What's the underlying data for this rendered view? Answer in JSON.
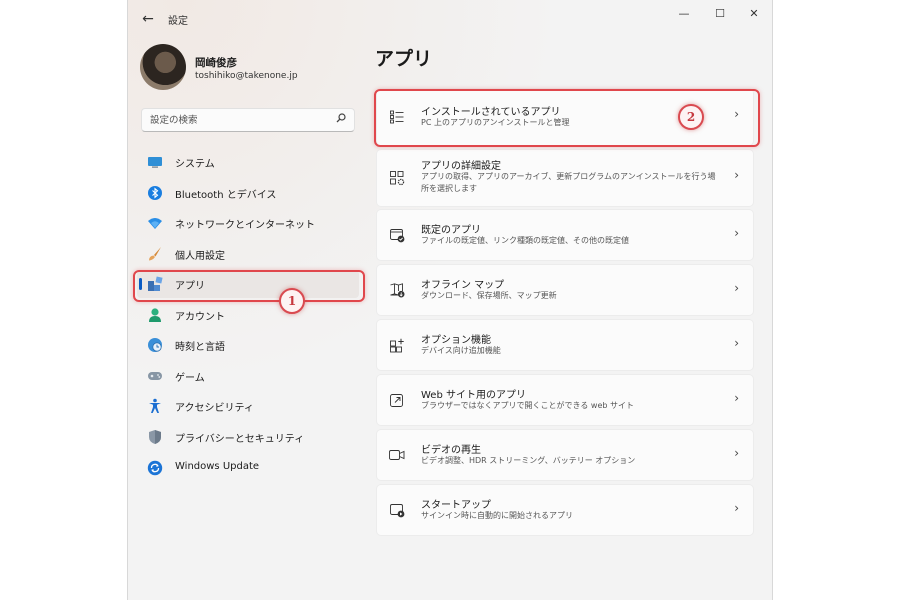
{
  "window": {
    "title": "設定"
  },
  "titlebar": {
    "back_glyph": "←",
    "minimize_glyph": "—",
    "maximize_glyph": "☐",
    "close_glyph": "✕"
  },
  "profile": {
    "name": "岡崎俊彦",
    "email": "toshihiko@takenone.jp"
  },
  "search": {
    "placeholder": "設定の検索",
    "icon": "search-icon"
  },
  "sidebar": {
    "items": [
      {
        "label": "システム",
        "icon": "monitor-icon"
      },
      {
        "label": "Bluetooth とデバイス",
        "icon": "bluetooth-icon"
      },
      {
        "label": "ネットワークとインターネット",
        "icon": "wifi-icon"
      },
      {
        "label": "個人用設定",
        "icon": "brush-icon"
      },
      {
        "label": "アプリ",
        "icon": "apps-icon",
        "selected": true
      },
      {
        "label": "アカウント",
        "icon": "person-icon"
      },
      {
        "label": "時刻と言語",
        "icon": "globe-clock-icon"
      },
      {
        "label": "ゲーム",
        "icon": "gamepad-icon"
      },
      {
        "label": "アクセシビリティ",
        "icon": "accessibility-icon"
      },
      {
        "label": "プライバシーとセキュリティ",
        "icon": "shield-icon"
      },
      {
        "label": "Windows Update",
        "icon": "update-icon"
      }
    ]
  },
  "main": {
    "title": "アプリ",
    "cards": [
      {
        "title": "インストールされているアプリ",
        "desc": "PC 上のアプリのアンインストールと管理",
        "icon": "list-icon"
      },
      {
        "title": "アプリの詳細設定",
        "desc": "アプリの取得、アプリのアーカイブ、更新プログラムのアンインストールを行う場所を選択します",
        "icon": "app-settings-icon"
      },
      {
        "title": "既定のアプリ",
        "desc": "ファイルの既定値、リンク種類の既定値、その他の既定値",
        "icon": "default-app-icon"
      },
      {
        "title": "オフライン マップ",
        "desc": "ダウンロード、保存場所、マップ更新",
        "icon": "map-download-icon"
      },
      {
        "title": "オプション機能",
        "desc": "デバイス向け追加機能",
        "icon": "add-features-icon"
      },
      {
        "title": "Web サイト用のアプリ",
        "desc": "ブラウザーではなくアプリで開くことができる web サイト",
        "icon": "open-external-icon"
      },
      {
        "title": "ビデオの再生",
        "desc": "ビデオ調整、HDR ストリーミング、バッテリー オプション",
        "icon": "video-icon"
      },
      {
        "title": "スタートアップ",
        "desc": "サインイン時に自動的に開始されるアプリ",
        "icon": "startup-icon"
      }
    ],
    "chevron_glyph": "›"
  },
  "annotations": {
    "badge_1": "1",
    "badge_2": "2",
    "color": "#e0474c"
  }
}
